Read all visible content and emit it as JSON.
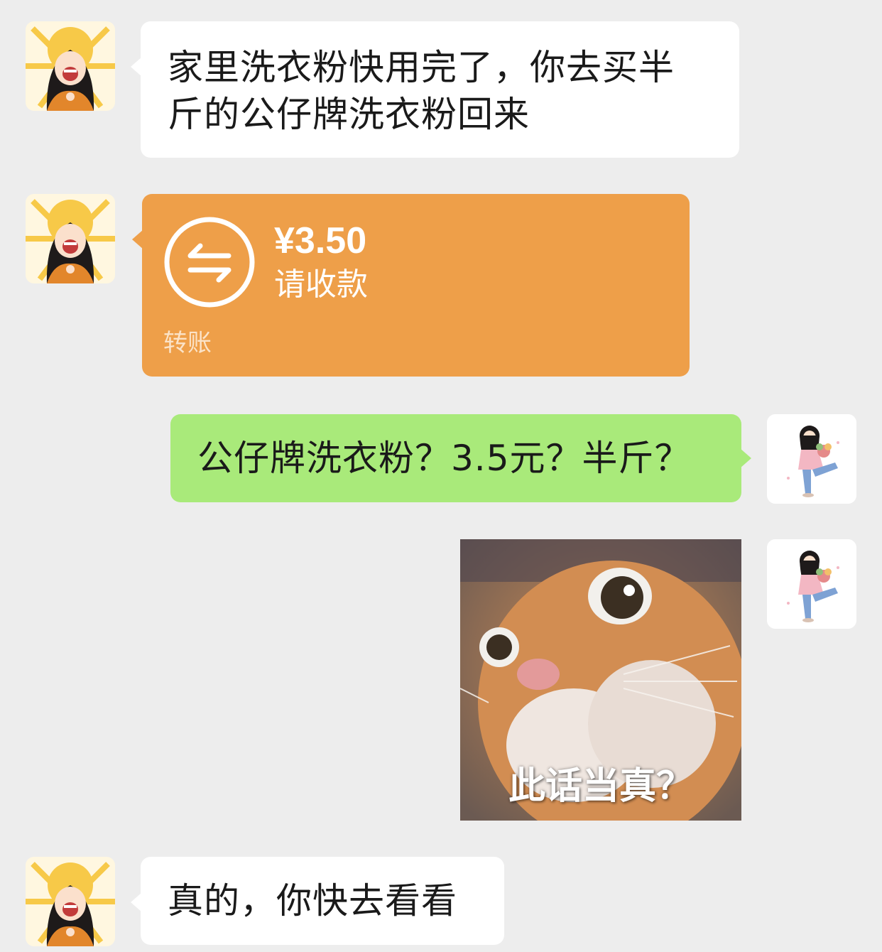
{
  "messages": [
    {
      "sender": "other",
      "type": "text",
      "text_line1": "家里洗衣粉快用完了，你去买半",
      "text_line2": "斤的公仔牌洗衣粉回来"
    },
    {
      "sender": "other",
      "type": "transfer",
      "amount": "¥3.50",
      "status": "请收款",
      "label": "转账"
    },
    {
      "sender": "me",
      "type": "text",
      "text": "公仔牌洗衣粉？3.5元？半斤？"
    },
    {
      "sender": "me",
      "type": "sticker",
      "caption": "此话当真？",
      "icon": "cat-meme-image"
    },
    {
      "sender": "other",
      "type": "text",
      "text": "真的，你快去看看"
    }
  ],
  "colors": {
    "background": "#ededed",
    "bubble_other": "#ffffff",
    "bubble_self": "#a9ea7a",
    "transfer": "#ee9f49"
  }
}
